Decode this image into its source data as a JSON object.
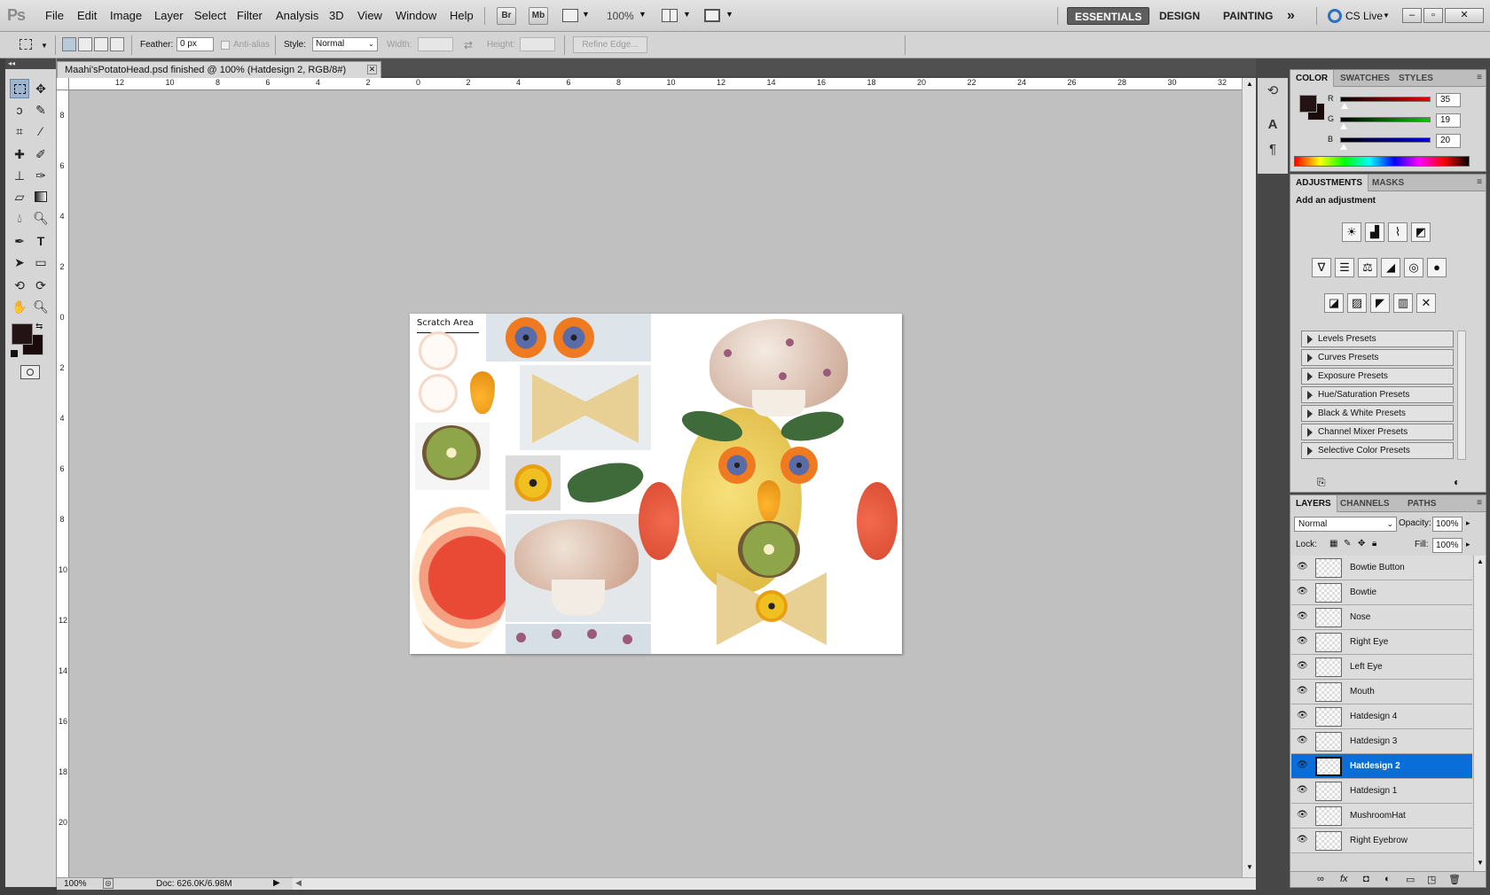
{
  "app": {
    "logo": "Ps"
  },
  "menu": [
    "File",
    "Edit",
    "Image",
    "Layer",
    "Select",
    "Filter",
    "Analysis",
    "3D",
    "View",
    "Window",
    "Help"
  ],
  "menubar": {
    "bridge_label": "Br",
    "minibridge_label": "Mb",
    "zoom_value": "100%",
    "workspaces": [
      "ESSENTIALS",
      "DESIGN",
      "PAINTING"
    ],
    "more_glyph": "»",
    "cslive_label": "CS Live"
  },
  "options": {
    "feather_label": "Feather:",
    "feather_value": "0 px",
    "antialias_label": "Anti-alias",
    "style_label": "Style:",
    "style_value": "Normal",
    "width_label": "Width:",
    "height_label": "Height:",
    "refine_label": "Refine Edge..."
  },
  "document": {
    "tab_title": "Maahi'sPotatoHead.psd finished @ 100% (Hatdesign 2, RGB/8#)",
    "scratch_label": "Scratch Area",
    "zoom": "100%",
    "doc_info": "Doc: 626.0K/6.98M"
  },
  "rulers": {
    "top": [
      "12",
      "10",
      "8",
      "6",
      "4",
      "2",
      "0",
      "2",
      "4",
      "6",
      "8",
      "10",
      "12",
      "14",
      "16",
      "18",
      "20",
      "22",
      "24",
      "26",
      "28",
      "30",
      "32"
    ],
    "left": [
      "8",
      "6",
      "4",
      "2",
      "0",
      "2",
      "4",
      "6",
      "8",
      "10",
      "12",
      "14",
      "16",
      "18",
      "20"
    ]
  },
  "color_panel": {
    "tabs": [
      "COLOR",
      "SWATCHES",
      "STYLES"
    ],
    "r_label": "R",
    "g_label": "G",
    "b_label": "B",
    "r_value": "35",
    "g_value": "19",
    "b_value": "20",
    "foreground": "#231314",
    "background": "#1a0a0c"
  },
  "adjustments_panel": {
    "tabs": [
      "ADJUSTMENTS",
      "MASKS"
    ],
    "heading": "Add an adjustment",
    "presets": [
      "Levels Presets",
      "Curves Presets",
      "Exposure Presets",
      "Hue/Saturation Presets",
      "Black & White Presets",
      "Channel Mixer Presets",
      "Selective Color Presets"
    ]
  },
  "layers_panel": {
    "tabs": [
      "LAYERS",
      "CHANNELS",
      "PATHS"
    ],
    "blend_mode": "Normal",
    "opacity_label": "Opacity:",
    "opacity": "100%",
    "lock_label": "Lock:",
    "fill_label": "Fill:",
    "fill": "100%",
    "layers": [
      "Bowtie Button",
      "Bowtie",
      "Nose",
      "Right Eye",
      "Left Eye",
      "Mouth",
      "Hatdesign 4",
      "Hatdesign 3",
      "Hatdesign 2",
      "Hatdesign 1",
      "MushroomHat",
      "Right Eyebrow"
    ],
    "selected": "Hatdesign 2",
    "selection_color": "#0a6ed8"
  }
}
